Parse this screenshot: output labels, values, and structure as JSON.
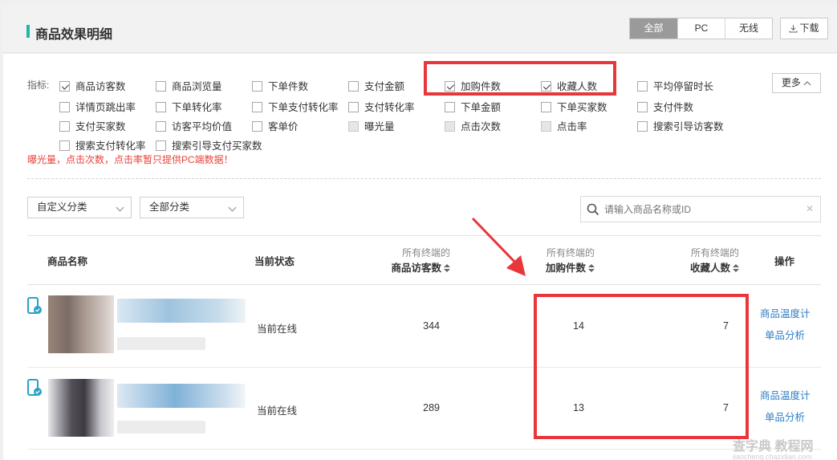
{
  "header": {
    "title": "商品效果明细",
    "segments": [
      "全部",
      "PC",
      "无线"
    ],
    "download_label": "下载"
  },
  "indicators": {
    "label": "指标:",
    "options": [
      {
        "label": "商品访客数",
        "checked": true
      },
      {
        "label": "商品浏览量",
        "checked": false
      },
      {
        "label": "下单件数",
        "checked": false
      },
      {
        "label": "支付金额",
        "checked": false
      },
      {
        "label": "加购件数",
        "checked": true
      },
      {
        "label": "收藏人数",
        "checked": true
      },
      {
        "label": "平均停留时长",
        "checked": false
      },
      {
        "label": "详情页跳出率",
        "checked": false
      },
      {
        "label": "下单转化率",
        "checked": false
      },
      {
        "label": "下单支付转化率",
        "checked": false
      },
      {
        "label": "支付转化率",
        "checked": false
      },
      {
        "label": "下单金额",
        "checked": false
      },
      {
        "label": "下单买家数",
        "checked": false
      },
      {
        "label": "支付件数",
        "checked": false
      },
      {
        "label": "支付买家数",
        "checked": false
      },
      {
        "label": "访客平均价值",
        "checked": false
      },
      {
        "label": "客单价",
        "checked": false
      },
      {
        "label": "曝光量",
        "checked": false,
        "disabled": true
      },
      {
        "label": "点击次数",
        "checked": false,
        "disabled": true
      },
      {
        "label": "点击率",
        "checked": false,
        "disabled": true
      },
      {
        "label": "搜索引导访客数",
        "checked": false
      },
      {
        "label": "搜索支付转化率",
        "checked": false
      },
      {
        "label": "搜索引导支付买家数",
        "checked": false
      }
    ],
    "more_label": "更多",
    "warning": "曝光量，点击次数，点击率暂只提供PC端数据！"
  },
  "filters": {
    "category_custom": "自定义分类",
    "category_all": "全部分类",
    "search_placeholder": "请输入商品名称或ID"
  },
  "table": {
    "col_name": "商品名称",
    "col_status": "当前状态",
    "col_visitors_sub": "所有终端的",
    "col_visitors": "商品访客数",
    "col_cart_sub": "所有终端的",
    "col_cart": "加购件数",
    "col_fav_sub": "所有终端的",
    "col_fav": "收藏人数",
    "col_ops": "操作",
    "rows": [
      {
        "status": "当前在线",
        "visitors": "344",
        "cart": "14",
        "fav": "7",
        "op1": "商品温度计",
        "op2": "单品分析"
      },
      {
        "status": "当前在线",
        "visitors": "289",
        "cart": "13",
        "fav": "7",
        "op1": "商品温度计",
        "op2": "单品分析"
      }
    ]
  },
  "watermark": {
    "main": "查字典 教程网",
    "sub": "jiaocheng.chazidian.com"
  },
  "colors": {
    "accent": "#1fb5ad",
    "highlight": "#e8363b",
    "link": "#2d7dc8",
    "warning": "#e9413a"
  }
}
